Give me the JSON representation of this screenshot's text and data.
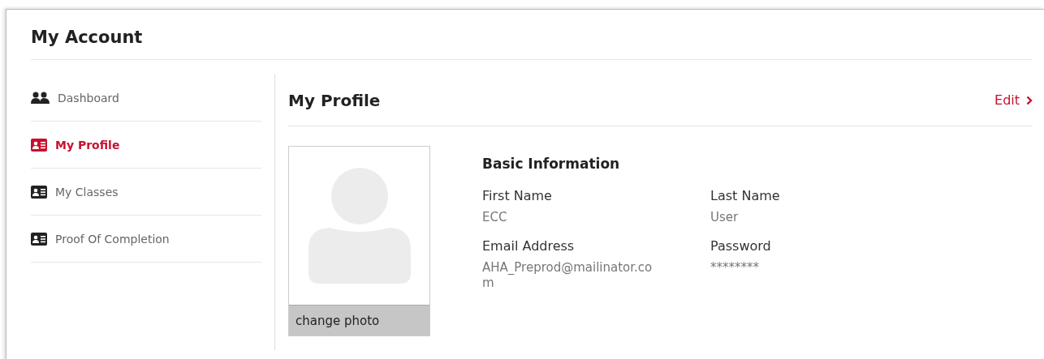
{
  "page_title": "My Account",
  "sidebar": {
    "items": [
      {
        "label": "Dashboard",
        "kind": "users",
        "selected": false
      },
      {
        "label": "My Profile",
        "kind": "card",
        "selected": true
      },
      {
        "label": "My Classes",
        "kind": "card",
        "selected": false
      },
      {
        "label": "Proof Of Completion",
        "kind": "card",
        "selected": false
      }
    ]
  },
  "profile": {
    "title": "My Profile",
    "edit_link": "Edit",
    "photo": {
      "button": "change photo"
    },
    "section_title": "Basic Information",
    "fields": [
      {
        "label": "First Name",
        "value": "ECC"
      },
      {
        "label": "Last Name",
        "value": "User"
      },
      {
        "label": "Email Address",
        "value": "AHA_Preprod@mailinator.com"
      },
      {
        "label": "Password",
        "value": "********"
      }
    ]
  }
}
